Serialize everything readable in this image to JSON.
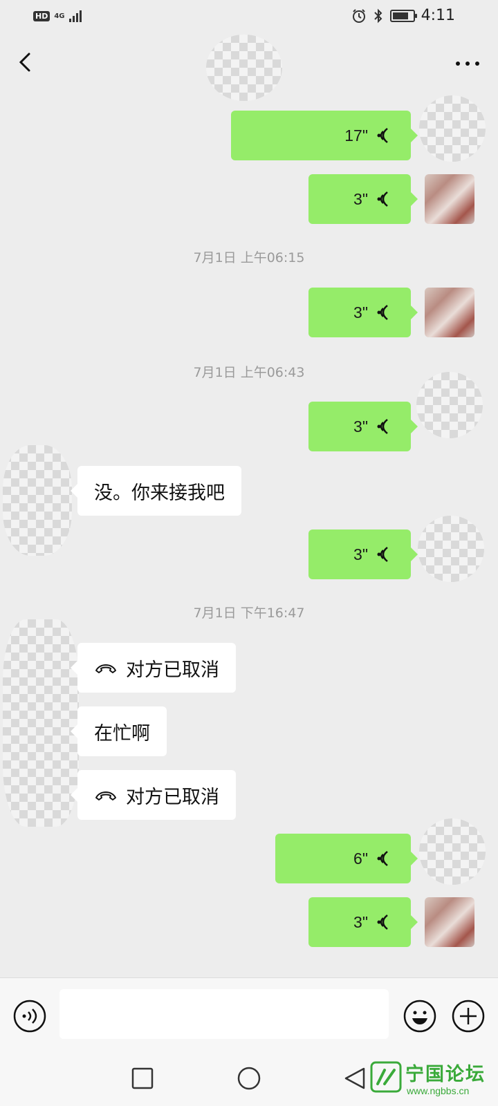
{
  "status_bar": {
    "badge": "HD",
    "network": "4G",
    "time": "4:11",
    "battery_level": 0.8
  },
  "header": {
    "title": "",
    "back_icon": "chevron-left-icon",
    "more_icon": "ellipsis-icon"
  },
  "messages": [
    {
      "kind": "voice",
      "side": "sent",
      "duration": "17\""
    },
    {
      "kind": "voice",
      "side": "sent",
      "duration": "3\""
    },
    {
      "kind": "timestamp",
      "text": "7月1日 上午06:15"
    },
    {
      "kind": "voice",
      "side": "sent",
      "duration": "3\""
    },
    {
      "kind": "timestamp",
      "text": "7月1日 上午06:43"
    },
    {
      "kind": "voice",
      "side": "sent",
      "duration": "3\""
    },
    {
      "kind": "text",
      "side": "received",
      "text": "没。你来接我吧"
    },
    {
      "kind": "voice",
      "side": "sent",
      "duration": "3\""
    },
    {
      "kind": "timestamp",
      "text": "7月1日 下午16:47"
    },
    {
      "kind": "call",
      "side": "received",
      "text": "对方已取消"
    },
    {
      "kind": "text",
      "side": "received",
      "text": "在忙啊"
    },
    {
      "kind": "call",
      "side": "received",
      "text": "对方已取消"
    },
    {
      "kind": "voice",
      "side": "sent",
      "duration": "6\""
    },
    {
      "kind": "voice",
      "side": "sent",
      "duration": "3\""
    }
  ],
  "input_bar": {
    "value": "",
    "voice_icon": "voice-mode-icon",
    "emoji_icon": "emoji-icon",
    "plus_icon": "plus-icon"
  },
  "nav_bar": {
    "recents_icon": "square-icon",
    "home_icon": "circle-icon",
    "back_icon": "triangle-back-icon"
  },
  "watermark": {
    "title": "宁国论坛",
    "url": "www.ngbbs.cn"
  },
  "colors": {
    "sent_bubble": "#95ec69",
    "received_bubble": "#ffffff",
    "background": "#ededed",
    "watermark": "#3aaa3a"
  }
}
